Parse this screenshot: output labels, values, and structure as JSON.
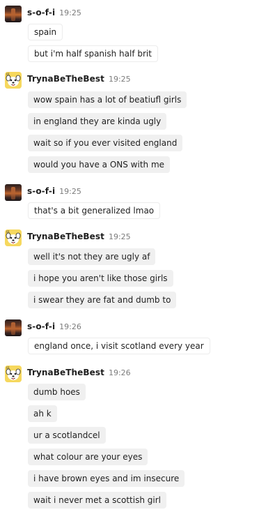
{
  "groups": [
    {
      "username": "s-o-f-i",
      "time": "19:25",
      "avatar_icon": "photo-avatar",
      "messages": [
        "spain",
        "but i'm half spanish half brit"
      ]
    },
    {
      "username": "TrynaBeTheBest",
      "time": "19:25",
      "avatar_icon": "bot-avatar",
      "messages": [
        "wow spain has a lot of beatiufl girls",
        "in england they are kinda ugly",
        "wait so if you ever visited england",
        "would you have a ONS with me"
      ]
    },
    {
      "username": "s-o-f-i",
      "time": "19:25",
      "avatar_icon": "photo-avatar",
      "messages": [
        "that's a bit generalized lmao"
      ]
    },
    {
      "username": "TrynaBeTheBest",
      "time": "19:25",
      "avatar_icon": "bot-avatar",
      "messages": [
        "well it's not they are ugly af",
        "i hope you aren't like those girls",
        "i swear they are fat and dumb to"
      ]
    },
    {
      "username": "s-o-f-i",
      "time": "19:26",
      "avatar_icon": "photo-avatar",
      "messages": [
        "england once, i visit scotland every year"
      ]
    },
    {
      "username": "TrynaBeTheBest",
      "time": "19:26",
      "avatar_icon": "bot-avatar",
      "messages": [
        "dumb hoes",
        "ah k",
        "ur a scotlandcel",
        "what colour are your eyes",
        "i have brown eyes and im insecure",
        "wait i never met a scottish girl"
      ]
    }
  ]
}
